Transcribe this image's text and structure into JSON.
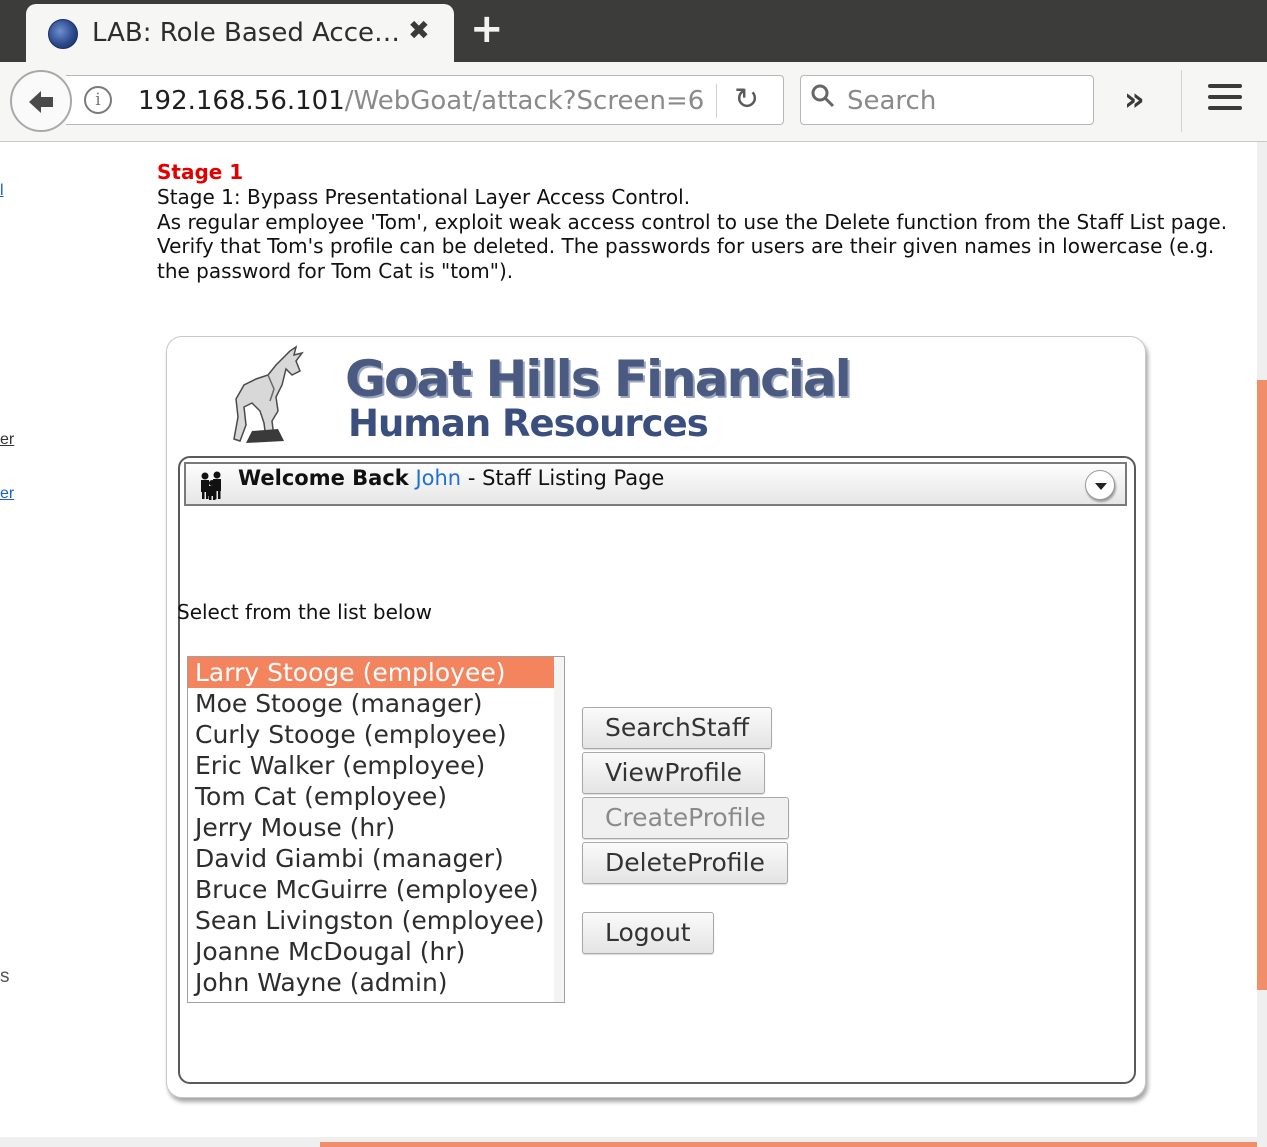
{
  "browser": {
    "tab_title": "LAB: Role Based Acce…",
    "tab_close": "✖",
    "new_tab": "+",
    "url_host": "192.168.56.101",
    "url_path": "/WebGoat/attack?Screen=6",
    "search_placeholder": "Search",
    "overflow": "»"
  },
  "left_fragments": [
    {
      "text": "l",
      "color": "#1a5fd6"
    },
    {
      "text": "er",
      "color": "#333333"
    },
    {
      "text": "er",
      "color": "#1a5fd6"
    },
    {
      "text": "s",
      "color": "#555555"
    }
  ],
  "stage": {
    "title": "Stage 1",
    "line1": "Stage 1: Bypass Presentational Layer Access Control.",
    "line2": "As regular employee 'Tom', exploit weak access control to use the Delete function from the Staff List page. Verify that Tom's profile can be deleted. The passwords for users are their given names in lowercase (e.g. the password for Tom Cat is \"tom\")."
  },
  "app": {
    "logo_title": "Goat Hills Financial",
    "logo_subtitle": "Human Resources",
    "welcome_prefix": "Welcome Back",
    "welcome_name": "John",
    "welcome_suffix": "- Staff Listing Page",
    "select_label": "Select from the list below",
    "staff": [
      "Larry Stooge (employee)",
      "Moe Stooge (manager)",
      "Curly Stooge (employee)",
      "Eric Walker (employee)",
      "Tom Cat (employee)",
      "Jerry Mouse (hr)",
      "David Giambi (manager)",
      "Bruce McGuirre (employee)",
      "Sean Livingston (employee)",
      "Joanne McDougal (hr)",
      "John Wayne (admin)"
    ],
    "selected_index": 0,
    "buttons": {
      "search_staff": "SearchStaff",
      "view_profile": "ViewProfile",
      "create_profile": "CreateProfile",
      "delete_profile": "DeleteProfile",
      "logout": "Logout"
    }
  },
  "colors": {
    "stage_title": "#e30000",
    "selection": "#f3845e",
    "link": "#1e6fd6",
    "scroll_thumb": "#f08e69"
  }
}
